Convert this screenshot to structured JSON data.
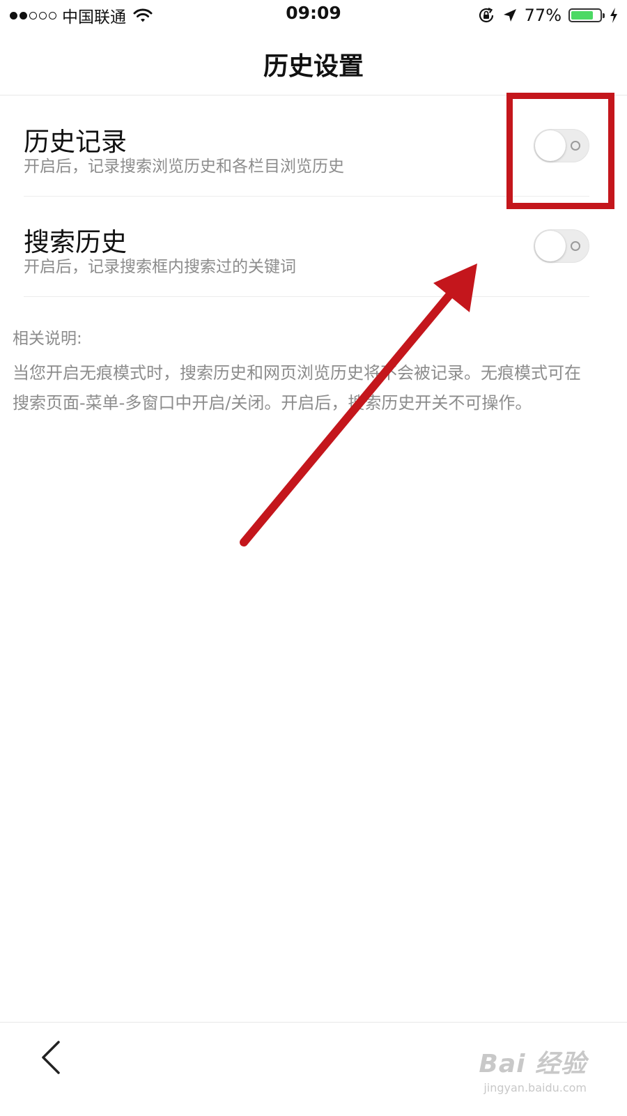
{
  "status_bar": {
    "carrier": "中国联通",
    "time": "09:09",
    "battery_percent_label": "77%",
    "battery_level": 0.77,
    "signal_strength": 2,
    "icons": [
      "wifi-icon",
      "orientation-lock-icon",
      "location-arrow-icon",
      "battery-icon",
      "charging-bolt-icon"
    ]
  },
  "header": {
    "title": "历史设置"
  },
  "settings": [
    {
      "title": "历史记录",
      "description": "开启后，记录搜索浏览历史和各栏目浏览历史",
      "enabled": false
    },
    {
      "title": "搜索历史",
      "description": "开启后，记录搜索框内搜索过的关键词",
      "enabled": false
    }
  ],
  "notes": {
    "title": "相关说明:",
    "body": "当您开启无痕模式时，搜索历史和网页浏览历史将不会被记录。无痕模式可在搜索页面-菜单-多窗口中开启/关闭。开启后，搜索历史开关不可操作。"
  },
  "bottom_bar": {
    "back_icon": "chevron-left-icon"
  },
  "watermark": {
    "logo": "Bai 经验",
    "url": "jingyan.baidu.com"
  },
  "colors": {
    "annotation_red": "#c4161c",
    "battery_green": "#4cd964",
    "toggle_off": "#ececec",
    "secondary_text": "#8c8c8c"
  }
}
